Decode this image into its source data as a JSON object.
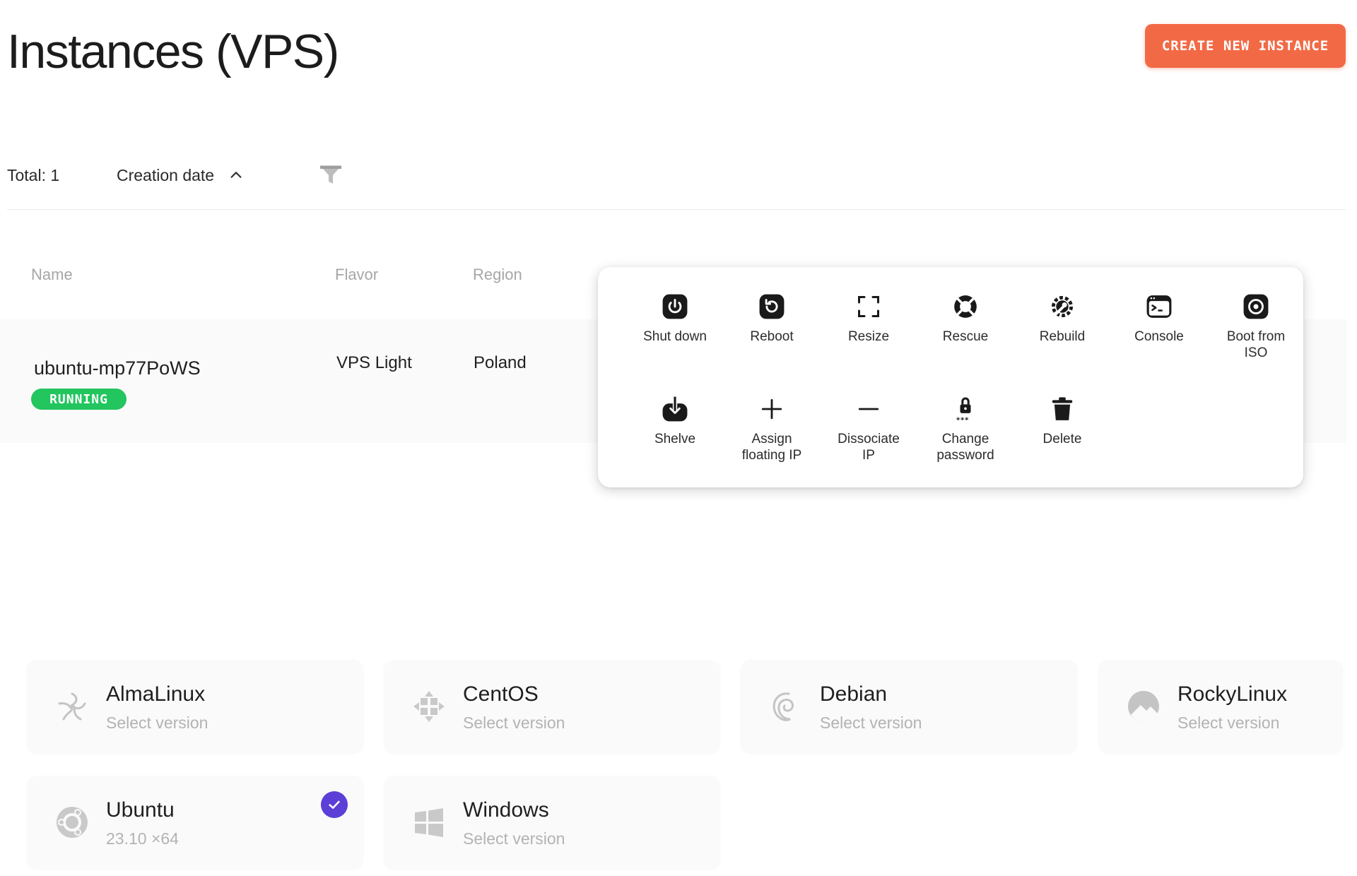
{
  "header": {
    "title": "Instances (VPS)",
    "create_button": "CREATE NEW INSTANCE"
  },
  "toolbar": {
    "total_label": "Total: 1",
    "sort_label": "Creation date"
  },
  "table": {
    "columns": [
      "Name",
      "Flavor",
      "Region"
    ],
    "rows": [
      {
        "name": "ubuntu-mp77PoWS",
        "status": "RUNNING",
        "flavor": "VPS Light",
        "region": "Poland"
      }
    ]
  },
  "actions_menu": {
    "items": [
      {
        "label": "Shut down",
        "icon": "power-icon"
      },
      {
        "label": "Reboot",
        "icon": "reboot-icon"
      },
      {
        "label": "Resize",
        "icon": "resize-icon"
      },
      {
        "label": "Rescue",
        "icon": "lifebuoy-icon"
      },
      {
        "label": "Rebuild",
        "icon": "wrench-gear-icon"
      },
      {
        "label": "Console",
        "icon": "terminal-icon"
      },
      {
        "label": "Boot from\nISO",
        "icon": "disc-icon"
      },
      {
        "label": "Shelve",
        "icon": "shelve-icon"
      },
      {
        "label": "Assign\nfloating IP",
        "icon": "plus-icon"
      },
      {
        "label": "Dissociate\nIP",
        "icon": "minus-icon"
      },
      {
        "label": "Change\npassword",
        "icon": "lock-icon"
      },
      {
        "label": "Delete",
        "icon": "trash-icon"
      }
    ]
  },
  "os_images": [
    {
      "name": "AlmaLinux",
      "subtitle": "Select version",
      "icon": "almalinux-icon"
    },
    {
      "name": "CentOS",
      "subtitle": "Select version",
      "icon": "centos-icon"
    },
    {
      "name": "Debian",
      "subtitle": "Select version",
      "icon": "debian-icon"
    },
    {
      "name": "RockyLinux",
      "subtitle": "Select version",
      "icon": "rockylinux-icon"
    },
    {
      "name": "Ubuntu",
      "subtitle": "23.10 ×64",
      "icon": "ubuntu-icon",
      "selected": true
    },
    {
      "name": "Windows",
      "subtitle": "Select version",
      "icon": "windows-icon"
    }
  ],
  "colors": {
    "accent": "#f26a45",
    "running": "#22c55e",
    "selected_check": "#5b3fd6"
  }
}
